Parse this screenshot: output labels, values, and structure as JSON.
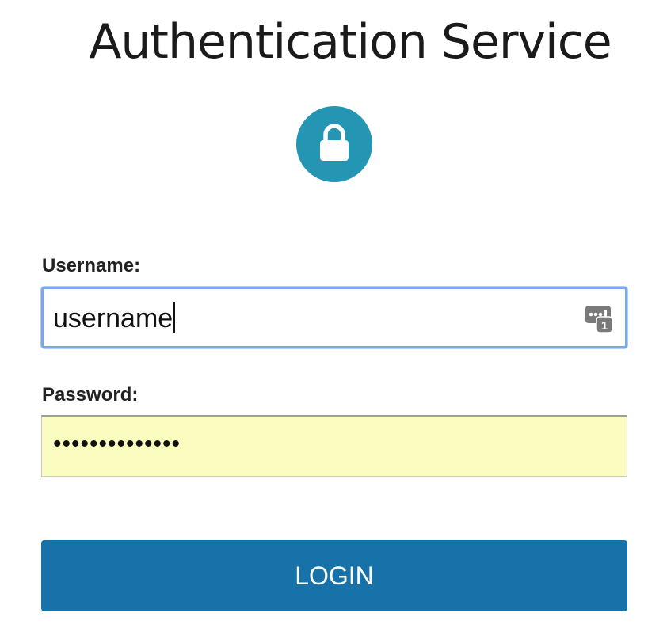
{
  "page": {
    "title": "Authentication Service",
    "accent_color": "#2595b4",
    "lock_icon": "lock-icon"
  },
  "form": {
    "username_label": "Username:",
    "username_value": "username",
    "password_label": "Password:",
    "password_value": "••••••••••••••",
    "autofill_icon": "password-manager-key-icon",
    "autofill_badge": "1",
    "login_label": "LOGIN",
    "login_color": "#1672a8",
    "password_autofill_bg": "#fafcc0"
  }
}
